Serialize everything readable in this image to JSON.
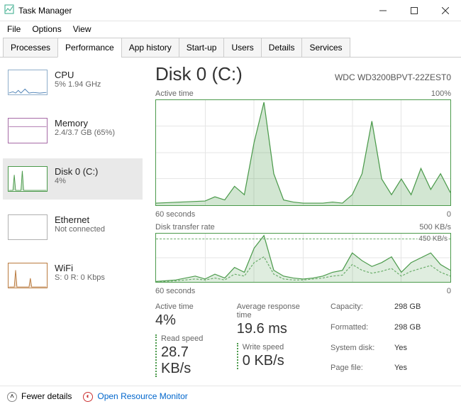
{
  "window": {
    "title": "Task Manager"
  },
  "menu": {
    "file": "File",
    "options": "Options",
    "view": "View"
  },
  "tabs": {
    "processes": "Processes",
    "performance": "Performance",
    "app_history": "App history",
    "startup": "Start-up",
    "users": "Users",
    "details": "Details",
    "services": "Services"
  },
  "sidebar": {
    "cpu": {
      "name": "CPU",
      "sub": "5%  1.94 GHz"
    },
    "memory": {
      "name": "Memory",
      "sub": "2.4/3.7 GB (65%)"
    },
    "disk": {
      "name": "Disk 0 (C:)",
      "sub": "4%"
    },
    "ethernet": {
      "name": "Ethernet",
      "sub": "Not connected"
    },
    "wifi": {
      "name": "WiFi",
      "sub": "S: 0 R: 0 Kbps"
    }
  },
  "main": {
    "title": "Disk 0 (C:)",
    "model": "WDC WD3200BPVT-22ZEST0",
    "active_time_label": "Active time",
    "active_time_max": "100%",
    "x_left": "60 seconds",
    "x_right": "0",
    "transfer_label": "Disk transfer rate",
    "transfer_max": "500 KB/s",
    "transfer_dash": "450 KB/s"
  },
  "stats": {
    "active_time_lbl": "Active time",
    "active_time_val": "4%",
    "avg_resp_lbl": "Average response time",
    "avg_resp_val": "19.6 ms",
    "read_lbl": "Read speed",
    "read_val": "28.7 KB/s",
    "write_lbl": "Write speed",
    "write_val": "0 KB/s"
  },
  "kv": {
    "capacity_k": "Capacity:",
    "capacity_v": "298 GB",
    "formatted_k": "Formatted:",
    "formatted_v": "298 GB",
    "sysdisk_k": "System disk:",
    "sysdisk_v": "Yes",
    "pagefile_k": "Page file:",
    "pagefile_v": "Yes"
  },
  "footer": {
    "fewer": "Fewer details",
    "orm": "Open Resource Monitor"
  },
  "chart_data": [
    {
      "type": "area",
      "title": "Active time",
      "ylabel": "%",
      "ylim": [
        0,
        100
      ],
      "xlabel": "seconds ago",
      "xlim": [
        60,
        0
      ],
      "x": [
        60,
        55,
        50,
        48,
        46,
        44,
        42,
        40,
        38,
        36,
        34,
        32,
        30,
        28,
        26,
        24,
        22,
        20,
        18,
        16,
        14,
        12,
        10,
        8,
        6,
        4,
        2,
        0
      ],
      "values": [
        2,
        3,
        4,
        8,
        5,
        18,
        10,
        60,
        98,
        30,
        5,
        3,
        2,
        2,
        2,
        3,
        2,
        10,
        30,
        80,
        25,
        10,
        25,
        10,
        35,
        15,
        30,
        12
      ]
    },
    {
      "type": "line",
      "title": "Disk transfer rate",
      "ylabel": "KB/s",
      "ylim": [
        0,
        500
      ],
      "xlabel": "seconds ago",
      "xlim": [
        60,
        0
      ],
      "annotations": [
        {
          "y": 450,
          "label": "450 KB/s"
        }
      ],
      "series": [
        {
          "name": "Read",
          "x": [
            60,
            56,
            52,
            50,
            48,
            46,
            44,
            42,
            40,
            38,
            36,
            34,
            32,
            30,
            28,
            26,
            24,
            22,
            20,
            18,
            16,
            14,
            12,
            10,
            8,
            6,
            4,
            2,
            0
          ],
          "values": [
            5,
            20,
            60,
            30,
            80,
            40,
            150,
            100,
            350,
            480,
            120,
            60,
            40,
            30,
            40,
            60,
            100,
            120,
            300,
            220,
            160,
            200,
            260,
            100,
            200,
            250,
            300,
            180,
            120
          ]
        },
        {
          "name": "Write",
          "x": [
            60,
            56,
            52,
            50,
            48,
            46,
            44,
            42,
            40,
            38,
            36,
            34,
            32,
            30,
            28,
            26,
            24,
            22,
            20,
            18,
            16,
            14,
            12,
            10,
            8,
            6,
            4,
            2,
            0
          ],
          "values": [
            0,
            10,
            30,
            20,
            40,
            20,
            80,
            60,
            200,
            260,
            80,
            30,
            20,
            20,
            30,
            40,
            60,
            70,
            180,
            120,
            90,
            110,
            140,
            60,
            110,
            140,
            170,
            100,
            60
          ]
        }
      ]
    }
  ]
}
